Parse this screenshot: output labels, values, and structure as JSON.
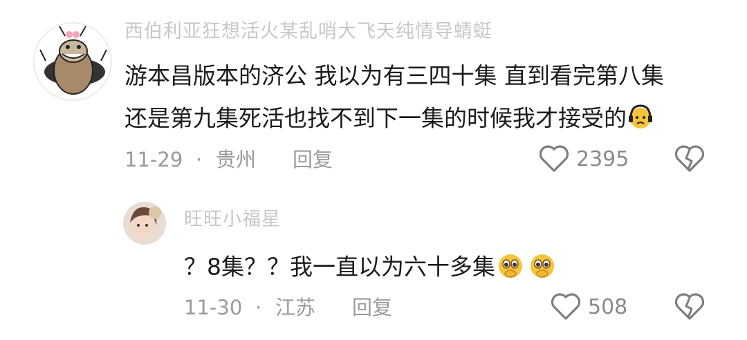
{
  "comments": [
    {
      "username": "西伯利亚狂想活火某乱哨大飞天纯情导蜻蜓",
      "line1": "游本昌版本的济公 我以为有三四十集 直到看完第八集",
      "line2": "还是第九集死活也找不到下一集的时候我才接受的",
      "line2_emoji": "sad-with-headphones-emoji",
      "date": "11-29",
      "separator": "·",
      "location": "贵州",
      "reply_label": "回复",
      "like_count": "2395",
      "avatar": "cockroach-cartoon-avatar"
    },
    {
      "username": "旺旺小福星",
      "line1": "？8集？？我一直以为六十多集",
      "line1_emoji": "pleading-face-emoji",
      "date": "11-30",
      "separator": "·",
      "location": "江苏",
      "reply_label": "回复",
      "like_count": "508",
      "avatar": "girl-photo-avatar"
    }
  ],
  "icons": {
    "like": "heart-outline-icon",
    "dislike": "broken-heart-icon"
  },
  "colors": {
    "text": "#1b1b1b",
    "meta": "#9a9a9a",
    "username": "#c7c7c7",
    "emoji_yellow": "#f6c43a"
  }
}
